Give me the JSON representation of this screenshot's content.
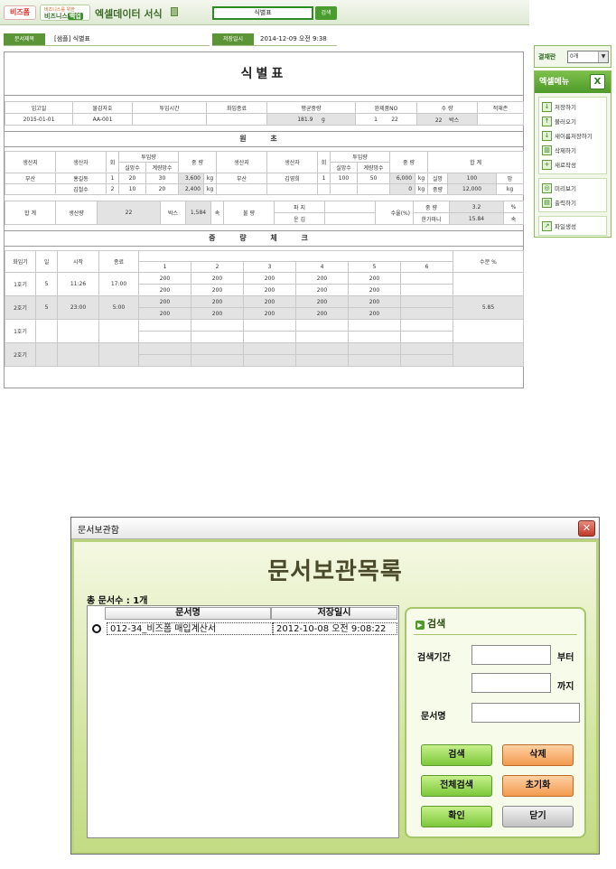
{
  "top": {
    "logo_primary": "비즈폼",
    "logo_secondary_tag": "비즈니스를 위한",
    "logo_secondary_left": "비즈니스",
    "logo_secondary_right": "백업",
    "title": "엑셀데이터 서식",
    "search_value": "식별표",
    "search_button": "검색"
  },
  "header": {
    "doc_label": "문서제목",
    "doc_title": "[샘플] 식별표",
    "saved_label": "저장일시",
    "saved_value": "2014-12-09 오전 9:38"
  },
  "sheet": {
    "title": "식별표",
    "info_headers": [
      "입고일",
      "물감자호",
      "투입시간",
      "화입종료",
      "평균중량",
      "완제품NO",
      "수 량",
      "적재존"
    ],
    "info_values": {
      "date": "2015-01-01",
      "code": "AA-001",
      "avg_weight": "181.9",
      "unit_g": "g",
      "product_no_a": "1",
      "product_no_b": "22",
      "qty": "22",
      "unit_box": "박스"
    },
    "raw_title": "원 초",
    "raw_headers": {
      "origin": "생산지",
      "producer": "생산자",
      "round": "회",
      "input": "투입량",
      "sub_count": "실망수",
      "sub_weight": "계량망수",
      "weight": "중 량",
      "total": "합 계",
      "unit_kg": "kg",
      "unit_mang": "망"
    },
    "raw_rows": [
      {
        "origin": "부산",
        "producer": "홍길동",
        "round": "1",
        "count": "20",
        "wcount": "30",
        "weight": "3,600",
        "origin2": "부산",
        "producer2": "김영희",
        "round2": "1",
        "count2": "100",
        "wcount2": "50",
        "weight2": "6,000",
        "total_label": "실망",
        "total_value": "100"
      },
      {
        "origin": "",
        "producer": "김철수",
        "round": "2",
        "count": "10",
        "wcount": "20",
        "weight": "2,400",
        "origin2": "",
        "producer2": "",
        "round2": "",
        "count2": "",
        "wcount2": "",
        "weight2": "0",
        "total_label": "중량",
        "total_value": "12,000"
      }
    ],
    "summary": {
      "total": "합 계",
      "production": "생산량",
      "prod_value": "22",
      "unit_box": "박스",
      "bundle_value": "1,584",
      "unit_sok": "속",
      "defect": "불 량",
      "pagi": "파 지",
      "ungim": "운 김",
      "yield": "수율(%)",
      "weight_label": "중 량",
      "weight_value": "3.2",
      "unit_pct": "%",
      "per_bundle_label": "한가마니",
      "per_bundle_value": "15.84",
      "unit_sok2": "속"
    },
    "weight_title": "중 량 체 크",
    "weight_headers": {
      "dryer": "화입기",
      "day": "일",
      "start": "시작",
      "end": "종료",
      "moisture": "수분 %"
    },
    "weight_cols": [
      "1",
      "2",
      "3",
      "4",
      "5",
      "6"
    ],
    "weight_rows": [
      {
        "dryer": "1호기",
        "day": "5",
        "start": "11:26",
        "end": "17:00",
        "line1": [
          "200",
          "200",
          "200",
          "200",
          "200",
          ""
        ],
        "line2": [
          "200",
          "200",
          "200",
          "200",
          "200",
          ""
        ],
        "moisture": ""
      },
      {
        "dryer": "2호기",
        "day": "5",
        "start": "23:00",
        "end": "5:00",
        "line1": [
          "200",
          "200",
          "200",
          "200",
          "200",
          ""
        ],
        "line2": [
          "200",
          "200",
          "200",
          "200",
          "200",
          ""
        ],
        "moisture": "5.85"
      },
      {
        "dryer": "1호기",
        "day": "",
        "start": "",
        "end": "",
        "line1": [
          "",
          "",
          "",
          "",
          "",
          ""
        ],
        "line2": [
          "",
          "",
          "",
          "",
          "",
          ""
        ],
        "moisture": ""
      },
      {
        "dryer": "2호기",
        "day": "",
        "start": "",
        "end": "",
        "line1": [
          "",
          "",
          "",
          "",
          "",
          ""
        ],
        "line2": [
          "",
          "",
          "",
          "",
          "",
          ""
        ],
        "moisture": ""
      }
    ]
  },
  "side": {
    "approval_label": "결재란",
    "approval_value": "0개",
    "menu_title": "엑셀메뉴",
    "group1": [
      "저장하기",
      "불러오기",
      "새이름저장하기",
      "삭제하기",
      "새로작성"
    ],
    "group2": [
      "미리보기",
      "출력하기"
    ],
    "group3": [
      "파일생성"
    ]
  },
  "dialog": {
    "window_title": "문서보관함",
    "heading": "문서보관목록",
    "total": "총 문서수 : 1개",
    "col_name": "문서명",
    "col_date": "저장일시",
    "row": {
      "name": "012-34_비즈폼 매입계산서",
      "date": "2012-10-08 오전 9:08:22"
    },
    "search_title": "검색",
    "period_label": "검색기간",
    "from_label": "부터",
    "to_label": "까지",
    "name_label": "문서명",
    "buttons": {
      "search": "검색",
      "delete": "삭제",
      "search_all": "전체검색",
      "reset": "초기화",
      "confirm": "확인",
      "close": "닫기"
    }
  }
}
